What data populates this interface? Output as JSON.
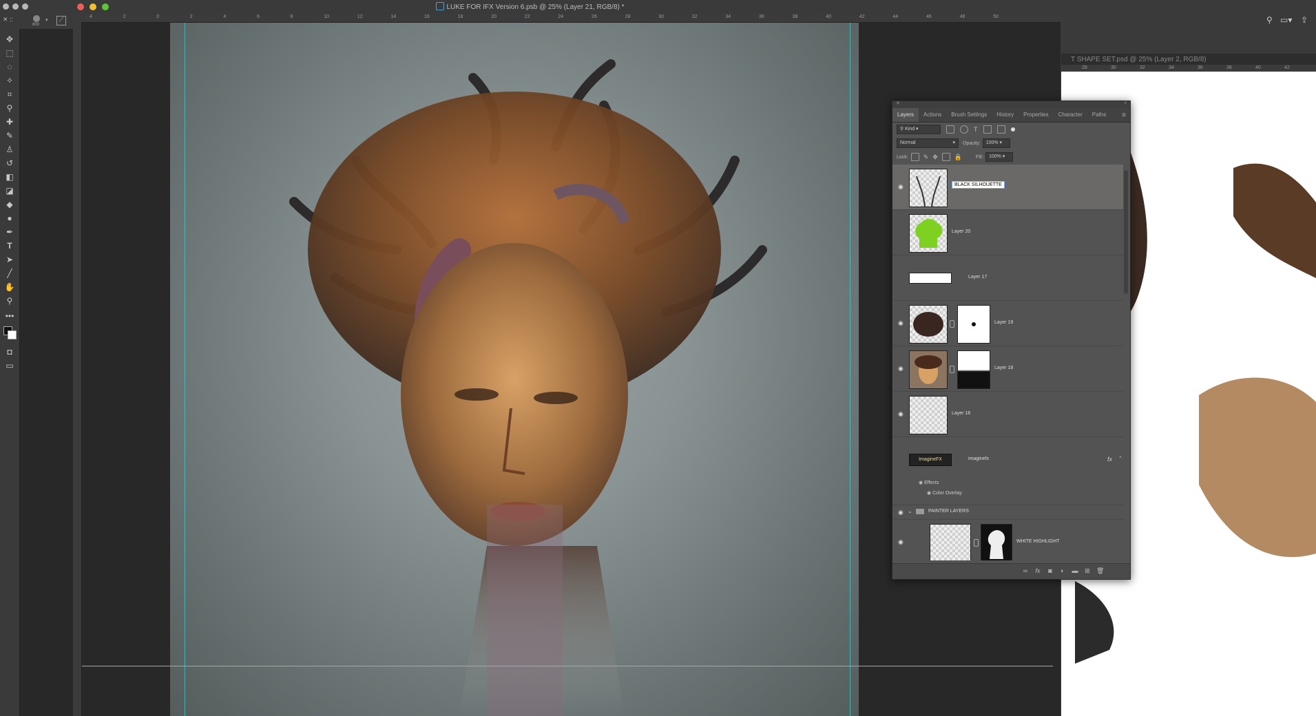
{
  "window": {
    "title": "LUKE FOR IFX Version 6.psb @ 25% (Layer 21, RGB/8) *"
  },
  "options_bar": {
    "brush_size": "800"
  },
  "ruler_top": [
    "4",
    "2",
    "0",
    "2",
    "4",
    "6",
    "8",
    "10",
    "12",
    "14",
    "16",
    "18",
    "20",
    "22",
    "24",
    "26",
    "28",
    "30",
    "32",
    "34",
    "36",
    "38",
    "40",
    "42",
    "44",
    "46",
    "48",
    "50"
  ],
  "doc2": {
    "title": "T SHAPE SET.psd @ 25% (Layer 2, RGB/8)",
    "ruler": [
      "28",
      "30",
      "32",
      "34",
      "36",
      "38",
      "40",
      "42"
    ]
  },
  "layers_panel": {
    "tabs": [
      "Layers",
      "Actions",
      "Brush Settings",
      "History",
      "Properties",
      "Character",
      "Paths"
    ],
    "filter_kind": "Kind",
    "blend_mode": "Normal",
    "opacity_label": "Opacity:",
    "opacity_value": "100%",
    "lock_label": "Lock:",
    "fill_label": "Fill:",
    "fill_value": "100%",
    "layers": [
      {
        "name": "BLACK SILHOUETTE",
        "visible": true,
        "selected": true
      },
      {
        "name": "Layer 20",
        "visible": false
      },
      {
        "name": "Layer 17",
        "visible": false
      },
      {
        "name": "Layer 19",
        "visible": true
      },
      {
        "name": "Layer 18",
        "visible": true
      },
      {
        "name": "Layer 16",
        "visible": true
      },
      {
        "name": "imaginefx",
        "visible": false,
        "fx": "fx"
      },
      {
        "name": "WHITE HIGHLIGHT",
        "visible": true
      }
    ],
    "effects_label": "Effects",
    "color_overlay_label": "Color Overlay",
    "group_name": "PAINTER LAYERS",
    "imaginefx_thumb_text": "ImagineFX"
  },
  "colors": {
    "accent_guide": "#41d2d2",
    "panel_bg": "#535353",
    "selected_layer": "#6b6868",
    "green_layer": "#7fd121"
  }
}
